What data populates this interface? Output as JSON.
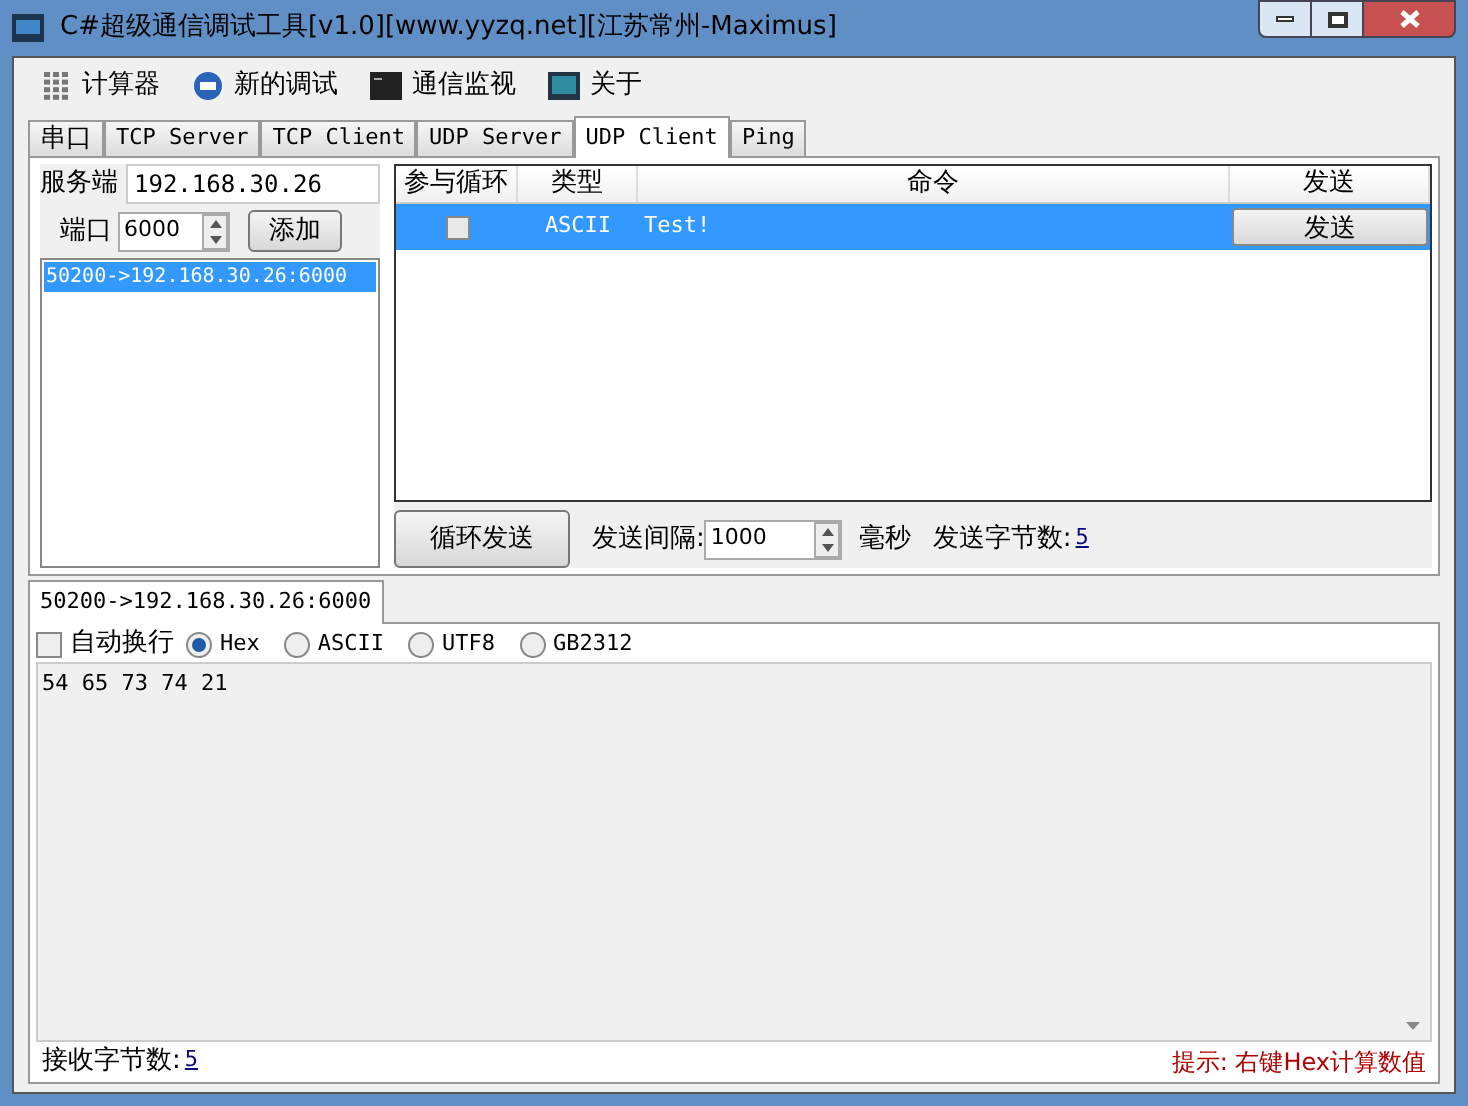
{
  "window": {
    "title": "C#超级通信调试工具[v1.0][www.yyzq.net][江苏常州-Maximus]"
  },
  "menu": [
    {
      "label": "计算器",
      "kind": "calc"
    },
    {
      "label": "新的调试",
      "kind": "new"
    },
    {
      "label": "通信监视",
      "kind": "monitor"
    },
    {
      "label": "关于",
      "kind": "about"
    }
  ],
  "tabs": [
    {
      "label": "串口",
      "selected": false
    },
    {
      "label": "TCP Server",
      "selected": false
    },
    {
      "label": "TCP Client",
      "selected": false
    },
    {
      "label": "UDP Server",
      "selected": false
    },
    {
      "label": "UDP Client",
      "selected": true
    },
    {
      "label": "Ping",
      "selected": false
    }
  ],
  "server": {
    "label": "服务端",
    "value": "192.168.30.26"
  },
  "port": {
    "label": "端口",
    "value": "6000",
    "button": "添加"
  },
  "connections": [
    {
      "label": "50200->192.168.30.26:6000",
      "selected": true
    }
  ],
  "table": {
    "columns": [
      "参与循环",
      "类型",
      "命令",
      "发送"
    ],
    "rows": [
      {
        "checked": false,
        "type": "ASCII",
        "command": "Test!",
        "button": "发送",
        "selected": true
      }
    ]
  },
  "loop_button": "循环发送",
  "interval": {
    "label": "发送间隔:",
    "value": "1000",
    "unit": "毫秒"
  },
  "sent_bytes": {
    "label": "发送字节数:",
    "value": "5"
  },
  "receive_tabs": [
    {
      "label": "50200->192.168.30.26:6000",
      "selected": true
    }
  ],
  "options": {
    "wrap": {
      "label": "自动换行",
      "checked": false
    },
    "encodings": [
      {
        "label": "Hex",
        "selected": true
      },
      {
        "label": "ASCII",
        "selected": false
      },
      {
        "label": "UTF8",
        "selected": false
      },
      {
        "label": "GB2312",
        "selected": false
      }
    ]
  },
  "received_text": "54 65 73 74 21",
  "status": {
    "label": "接收字节数:",
    "value": "5",
    "hint": "提示: 右键Hex计算数值"
  }
}
